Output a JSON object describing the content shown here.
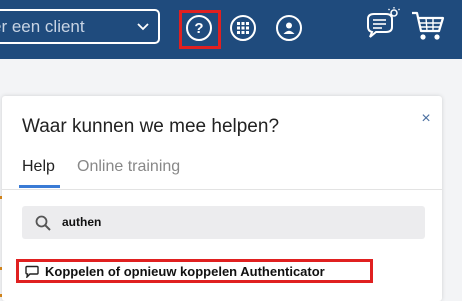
{
  "topbar": {
    "client_placeholder": "er een client",
    "help_label": "?"
  },
  "help_panel": {
    "title": "Waar kunnen we mee helpen?",
    "close_label": "×",
    "tabs": [
      {
        "label": "Help",
        "active": true
      },
      {
        "label": "Online training",
        "active": false
      }
    ],
    "search_query": "authen",
    "results": [
      {
        "label": "Koppelen of opnieuw koppelen Authenticator",
        "icon": "chat-bubble-icon"
      }
    ]
  },
  "colors": {
    "topbar": "#1f4b7d",
    "highlight": "#e02020",
    "tab_accent": "#3a7bd5"
  }
}
